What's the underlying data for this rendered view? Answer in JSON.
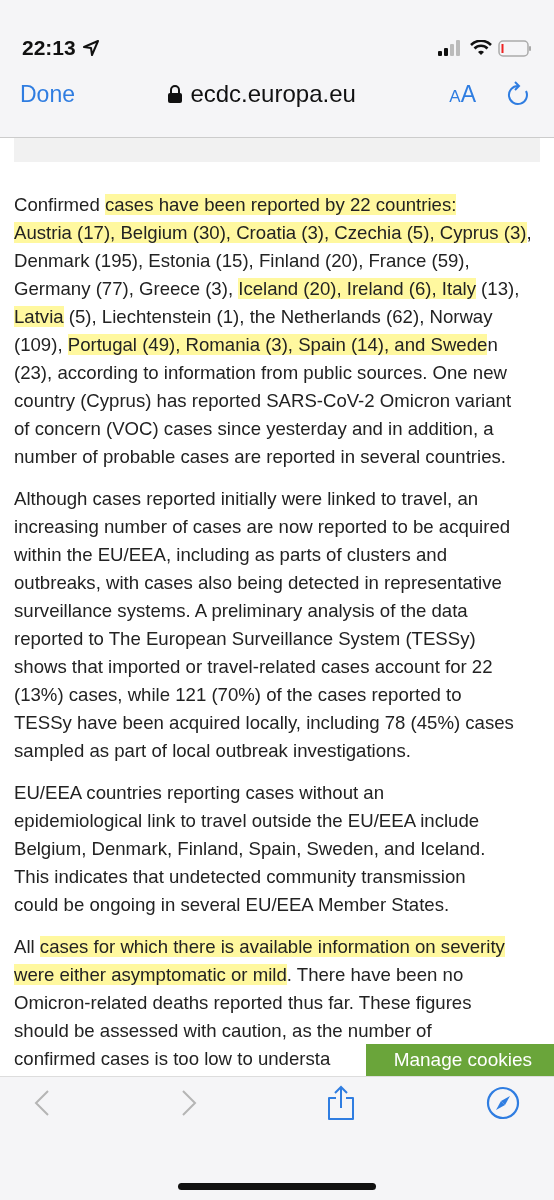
{
  "status_bar": {
    "time": "22:13"
  },
  "browser": {
    "done": "Done",
    "url": "ecdc.europa.eu",
    "text_size": "AA"
  },
  "content": {
    "paragraphs": [
      {
        "segments": [
          {
            "text": "Confirmed ",
            "highlighted": false
          },
          {
            "text": "cases have been reported by 22 countries:\nAustria (17), Belgium (30), Croatia (3), Czechia (5), Cyprus (3)",
            "highlighted": true
          },
          {
            "text": ",\nDenmark (195), Estonia (15), Finland (20), France (59),\nGermany (77), Greece (3), ",
            "highlighted": false
          },
          {
            "text": "Iceland (20), Ireland (6), Italy",
            "highlighted": true
          },
          {
            "text": " (13),\n",
            "highlighted": false
          },
          {
            "text": "Latvia",
            "highlighted": true
          },
          {
            "text": " (5), Liechtenstein (1), the Netherlands (62), Norway\n(109), ",
            "highlighted": false
          },
          {
            "text": "Portugal (49), Romania (3), Spain (14), and Swede",
            "highlighted": true
          },
          {
            "text": "n\n(23), according to information from public sources. One new\ncountry (Cyprus) has reported SARS-CoV-2 Omicron variant\nof concern (VOC) cases since yesterday and in addition, a\nnumber of probable cases are reported in several countries.",
            "highlighted": false
          }
        ]
      },
      {
        "segments": [
          {
            "text": "Although cases reported initially were linked to travel, an\nincreasing number of cases are now reported to be acquired\nwithin the EU/EEA, including as parts of clusters and\noutbreaks, with cases also being detected in representative\nsurveillance systems. A preliminary analysis of the data\nreported to The European Surveillance System (TESSy)\nshows that imported or travel-related cases account for 22\n(13%) cases, while 121 (70%) of the cases reported to\nTESSy have been acquired locally, including 78 (45%) cases\nsampled as part of local outbreak investigations.",
            "highlighted": false
          }
        ]
      },
      {
        "segments": [
          {
            "text": "EU/EEA countries reporting cases without an\nepidemiological link to travel outside the EU/EEA include\nBelgium, Denmark, Finland, Spain, Sweden, and Iceland.\nThis indicates that undetected community transmission\ncould be ongoing in several EU/EEA Member States.",
            "highlighted": false
          }
        ]
      },
      {
        "segments": [
          {
            "text": "All ",
            "highlighted": false
          },
          {
            "text": "cases for which there is available information on severity\nwere either asymptomatic or mild",
            "highlighted": true
          },
          {
            "text": ". There have been no\nOmicron-related deaths reported thus far. These figures\nshould be assessed with caution, as the number of\nconfirmed cases is too low to understa",
            "highlighted": false
          }
        ]
      }
    ],
    "cookie_button": "Manage cookies"
  },
  "toolbar": {
    "back_disabled": true,
    "forward_disabled": true
  }
}
